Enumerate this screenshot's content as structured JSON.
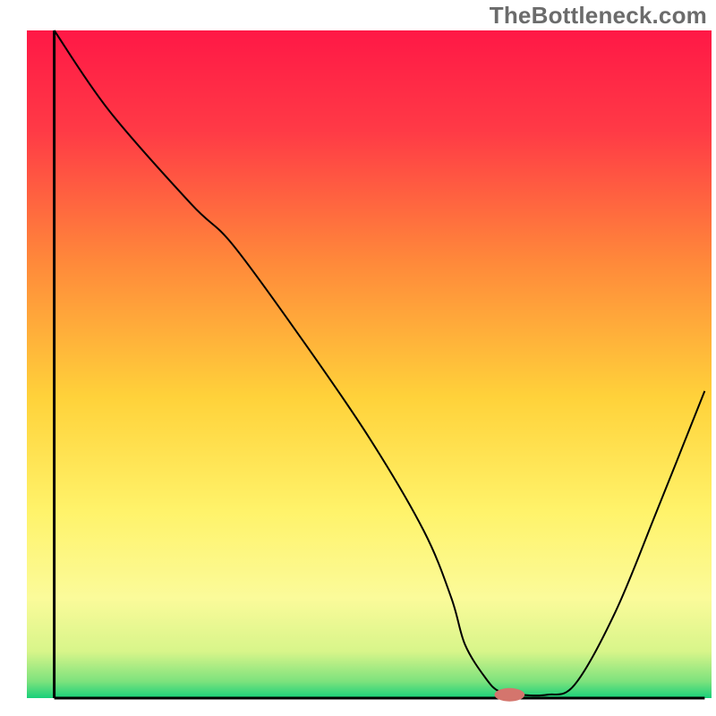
{
  "watermark": "TheBottleneck.com",
  "chart_data": {
    "type": "line",
    "title": "",
    "xlabel": "",
    "ylabel": "",
    "xlim": [
      0,
      100
    ],
    "ylim": [
      0,
      100
    ],
    "background_gradient": {
      "stops": [
        {
          "offset": 0.0,
          "color": "#ff1846"
        },
        {
          "offset": 0.15,
          "color": "#ff3a46"
        },
        {
          "offset": 0.35,
          "color": "#ff8a3a"
        },
        {
          "offset": 0.55,
          "color": "#ffd23a"
        },
        {
          "offset": 0.72,
          "color": "#fff36a"
        },
        {
          "offset": 0.85,
          "color": "#fbfb9a"
        },
        {
          "offset": 0.93,
          "color": "#d8f58a"
        },
        {
          "offset": 0.975,
          "color": "#7de27d"
        },
        {
          "offset": 1.0,
          "color": "#18d07a"
        }
      ]
    },
    "series": [
      {
        "name": "bottleneck-curve",
        "stroke": "#000000",
        "stroke_width": 2,
        "x": [
          4,
          12,
          24,
          30,
          40,
          50,
          58,
          62,
          64,
          67,
          69,
          72,
          76,
          80,
          86,
          92,
          99
        ],
        "y": [
          100,
          88,
          74,
          68,
          54,
          39,
          25,
          15,
          8,
          3,
          1,
          0.5,
          0.5,
          2,
          13,
          28,
          46
        ]
      }
    ],
    "marker": {
      "name": "current-config-marker",
      "cx": 70.5,
      "cy": 0.5,
      "rx": 2.2,
      "ry": 1.0,
      "fill": "#d4756d"
    },
    "axes": {
      "left": {
        "x": 4,
        "y1": 0,
        "y2": 100
      },
      "bottom": {
        "y": 0,
        "x1": 4,
        "x2": 99
      }
    }
  }
}
